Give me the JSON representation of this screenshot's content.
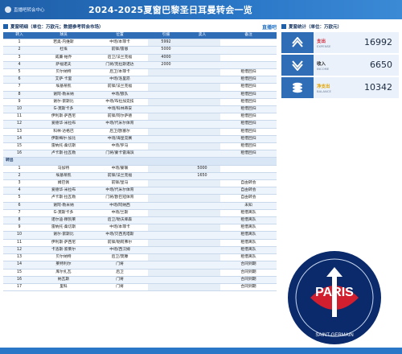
{
  "header": {
    "brand": "直播吧转会中心",
    "title": "2024-2025夏窗巴黎圣日耳曼转会一览"
  },
  "table": {
    "title": "夏窗明细（单位：万欧元；数据参考转会市场）",
    "brand": "直播吧",
    "columns": [
      "转入",
      "球员",
      "位置",
      "引援",
      "卖人",
      "备注"
    ],
    "in_rows": [
      [
        "1",
        "若奥·内维斯",
        "中场/本菲卡",
        "5992",
        "",
        ""
      ],
      [
        "2",
        "杜埃",
        "前锋/雷恩",
        "5000",
        "",
        ""
      ],
      [
        "3",
        "威廉·帕乔",
        "后卫/法兰克福",
        "4000",
        "",
        ""
      ],
      [
        "4",
        "萨福诺夫",
        "门将/克拉斯诺达",
        "2000",
        "",
        ""
      ],
      [
        "5",
        "贝尔纳特",
        "后卫/本菲卡",
        "",
        "",
        "租借回归"
      ],
      [
        "6",
        "艾萨·卡里",
        "中场/洛里昂",
        "",
        "",
        "租借回归"
      ],
      [
        "7",
        "埃基蒂凯",
        "前锋/法兰克福",
        "",
        "",
        "租借回归"
      ],
      [
        "8",
        "谢阿·勒米纳",
        "中场/狼队",
        "",
        "",
        "租借回归"
      ],
      [
        "9",
        "谢尔·索斯比",
        "中场/布拉加竞技",
        "",
        "",
        "租借回归"
      ],
      [
        "10",
        "G-莫斯卡多",
        "中场/科林蒂安",
        "",
        "",
        "租借回归"
      ],
      [
        "11",
        "伊利斯·萨西尼",
        "前锋/阿尔萨德",
        "",
        "",
        "租借回归"
      ],
      [
        "12",
        "爱德华·米拉布",
        "中场/代米尔体育",
        "",
        "",
        "租借回归"
      ],
      [
        "13",
        "科林·达格巴",
        "后卫/欧塞尔",
        "",
        "",
        "租借回归"
      ],
      [
        "14",
        "伊斯梅尔·加比",
        "中场/海皇竞赛",
        "",
        "",
        "租借回归"
      ],
      [
        "15",
        "雷纳托·桑切斯",
        "中场/罗马",
        "",
        "",
        "租借回归"
      ],
      [
        "16",
        "卢卡斯·拉瓦勒",
        "门将/蒙卡雷海滨",
        "",
        "",
        "租借回归"
      ]
    ],
    "out_label": "转出",
    "out_rows": [
      [
        "1",
        "马加特",
        "中场/蒙联",
        "",
        "5000",
        ""
      ],
      [
        "2",
        "埃基蒂凯",
        "前锋/法兰克福",
        "",
        "1650",
        ""
      ],
      [
        "3",
        "姆巴佩",
        "前锋/皇马",
        "",
        "",
        "自由转会"
      ],
      [
        "4",
        "爱德华·米拉布",
        "中场/代米尔体育",
        "",
        "",
        "自由转会"
      ],
      [
        "5",
        "卢卡斯·拉瓦勒",
        "门将/欧巴冠体育",
        "",
        "",
        "自由转会"
      ],
      [
        "6",
        "谢阿·勒米纳",
        "中场/阿纳西",
        "",
        "",
        "未知"
      ],
      [
        "7",
        "G-莫斯卡多",
        "中场/兰斯",
        "",
        "",
        "租借离队"
      ],
      [
        "8",
        "诺尔迪·穆凯莱",
        "后卫/勒沃库森",
        "",
        "",
        "租借离队"
      ],
      [
        "9",
        "雷纳托·桑切斯",
        "中场/本菲卡",
        "",
        "",
        "租借离队"
      ],
      [
        "10",
        "谢尔·索斯比",
        "中场/贝西克塔斯",
        "",
        "",
        "租借离队"
      ],
      [
        "11",
        "伊利斯·萨西尼",
        "前锋/勒阿弗尔",
        "",
        "",
        "租借离队"
      ],
      [
        "12",
        "卡洛斯·索莱尔",
        "中场/西汉姆",
        "",
        "",
        "租借离队"
      ],
      [
        "13",
        "贝尔纳特",
        "后卫/莫滕",
        "",
        "",
        "租借离队"
      ],
      [
        "14",
        "莱特利尔",
        "门将",
        "",
        "",
        "合同到期"
      ],
      [
        "15",
        "库尔扎瓦",
        "后卫",
        "",
        "",
        "合同到期"
      ],
      [
        "16",
        "纳瓦斯",
        "门将",
        "",
        "",
        "合同到期"
      ],
      [
        "17",
        "里科",
        "门将",
        "",
        "",
        "合同到期"
      ]
    ]
  },
  "stats": {
    "title": "夏窗统计（单位：万欧元）",
    "items": [
      {
        "label": "支出",
        "label_en": "EXPENSE",
        "value": "16992",
        "icon": "expense-icon"
      },
      {
        "label": "收入",
        "label_en": "INCOME",
        "value": "6650",
        "icon": "income-icon"
      },
      {
        "label": "净支出",
        "label_en": "BALANCE",
        "value": "10342",
        "icon": "balance-icon"
      }
    ]
  },
  "crest": {
    "name": "PARIS",
    "sub": "SAINT-GERMAIN"
  },
  "colors": {
    "primary": "#2a77c7",
    "header_dark": "#1f5fa8",
    "crest_blue": "#0a2a6b",
    "crest_red": "#d21f2f"
  }
}
